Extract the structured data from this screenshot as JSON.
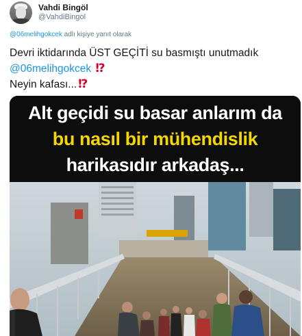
{
  "author": {
    "display_name": "Vahdi Bingöl",
    "handle": "@VahdiBingol"
  },
  "reply_context": {
    "mention": "@06melihgokcek",
    "suffix": " adlı kişiye yanıt olarak"
  },
  "tweet": {
    "line1": "Devri iktidarında ÜST GEÇİTİ su basmıştı unutmadık",
    "mention": "@06melihgokcek",
    "line3": "Neyin kafası...",
    "emoji": "⁉"
  },
  "image": {
    "caption_lines": [
      "Alt geçidi su basar anlarım da",
      "bu nasıl bir mühendislik",
      "harikasıdır arkadaş..."
    ],
    "caption_colors": [
      "#ffffff",
      "#f5d700",
      "#ffffff"
    ],
    "scene_icon": "flooded-overpass-photo"
  },
  "colors": {
    "link": "#1b95e0",
    "meta": "#657786",
    "text": "#14171a",
    "emoji": "#d4002a"
  }
}
